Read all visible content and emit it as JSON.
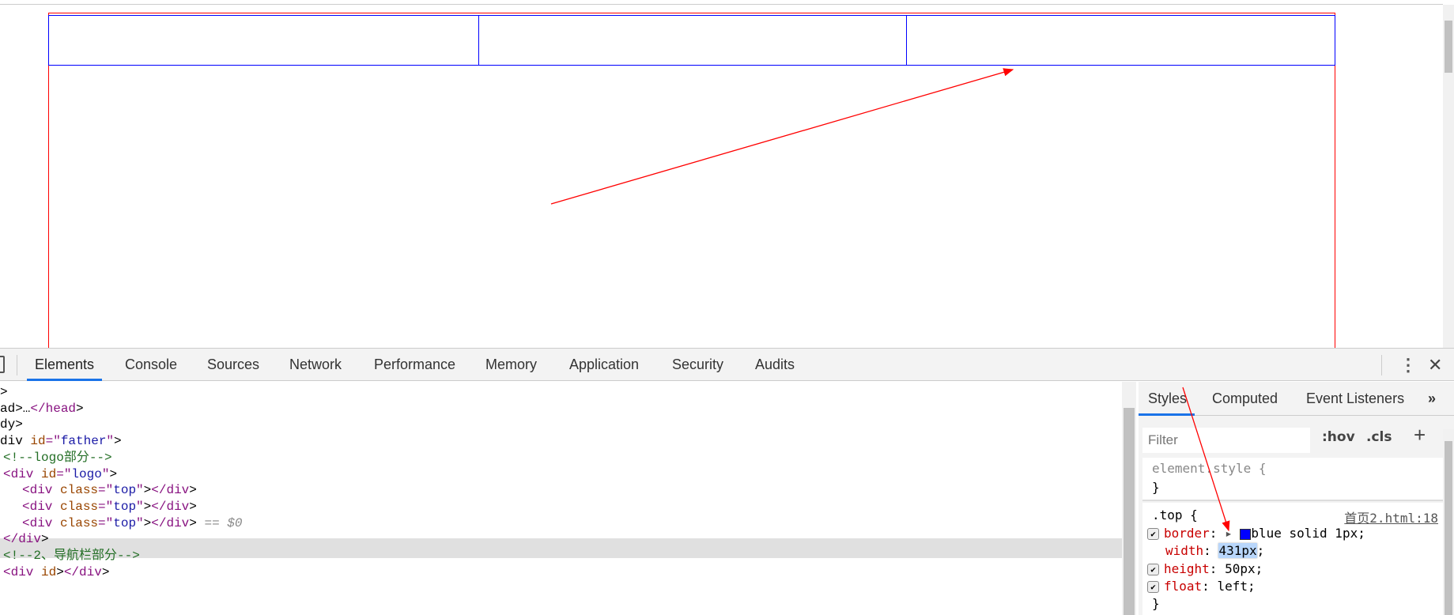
{
  "colors": {
    "father_border": "#ff0000",
    "box_border": "#0000ff",
    "accent": "#1a73e8"
  },
  "devtools": {
    "tabs": [
      "Elements",
      "Console",
      "Sources",
      "Network",
      "Performance",
      "Memory",
      "Application",
      "Security",
      "Audits"
    ],
    "active_tab": "Elements",
    "icons": {
      "more": "kebab-menu-icon",
      "close": "close-icon"
    },
    "dom_lines": [
      {
        "id": "l0",
        "text": ">"
      },
      {
        "id": "l1",
        "text": "ad>…</head>"
      },
      {
        "id": "l2",
        "text": "dy>"
      },
      {
        "id": "l3",
        "text": "div id=\"father\">"
      },
      {
        "id": "l4",
        "text": "<!--logo部分-->"
      },
      {
        "id": "l5",
        "text": "<div id=\"logo\">"
      },
      {
        "id": "l6",
        "text": "<div class=\"top\"></div>"
      },
      {
        "id": "l7",
        "text": "<div class=\"top\"></div>"
      },
      {
        "id": "l8",
        "text": "<div class=\"top\"></div>",
        "suffix": " == $0",
        "selected": true
      },
      {
        "id": "l9",
        "text": "</div>"
      },
      {
        "id": "l10",
        "text": "<!--2、导航栏部分-->"
      },
      {
        "id": "l11",
        "text": "<div id></div>"
      }
    ],
    "styles": {
      "tabs": [
        "Styles",
        "Computed",
        "Event Listeners"
      ],
      "more": "»",
      "filter_placeholder": "Filter",
      "hov": ":hov",
      "cls": ".cls",
      "add": "+",
      "element_style_open": "element.style {",
      "close_brace": "}",
      "rule_selector": ".top {",
      "rule_source": "首页2.html:18",
      "props": [
        {
          "name": "border",
          "value": "blue solid 1px;",
          "checked": true,
          "swatch": "#0000ff"
        },
        {
          "name": "width",
          "value": "431px",
          "checked": false,
          "editing": true
        },
        {
          "name": "height",
          "value": "50px;",
          "checked": true
        },
        {
          "name": "float",
          "value": "left;",
          "checked": true
        }
      ]
    }
  }
}
